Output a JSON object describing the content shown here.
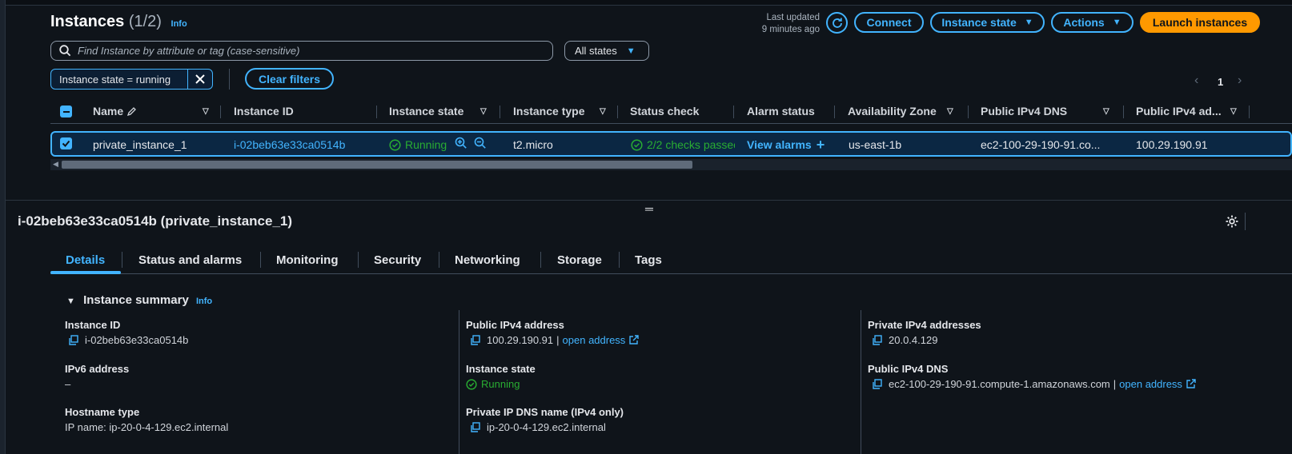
{
  "header": {
    "title": "Instances",
    "count": "(1/2)",
    "info": "Info",
    "last_updated_line1": "Last updated",
    "last_updated_line2": "9 minutes ago",
    "connect": "Connect",
    "instance_state": "Instance state",
    "actions": "Actions",
    "launch": "Launch instances"
  },
  "search": {
    "placeholder": "Find Instance by attribute or tag (case-sensitive)",
    "states": "All states"
  },
  "filters": {
    "token": "Instance state = running",
    "clear": "Clear filters"
  },
  "pagination": {
    "page": "1"
  },
  "table": {
    "columns": [
      "Name",
      "Instance ID",
      "Instance state",
      "Instance type",
      "Status check",
      "Alarm status",
      "Availability Zone",
      "Public IPv4 DNS",
      "Public IPv4 ad..."
    ],
    "row": {
      "name": "private_instance_1",
      "id": "i-02beb63e33ca0514b",
      "state": "Running",
      "type": "t2.micro",
      "status": "2/2 checks passec",
      "alarm": "View alarms",
      "az": "us-east-1b",
      "dns": "ec2-100-29-190-91.co...",
      "ipv4": "100.29.190.91"
    }
  },
  "detail": {
    "title": "i-02beb63e33ca0514b (private_instance_1)",
    "tabs": [
      "Details",
      "Status and alarms",
      "Monitoring",
      "Security",
      "Networking",
      "Storage",
      "Tags"
    ],
    "summary_title": "Instance summary",
    "info": "Info",
    "fields": {
      "instance_id_label": "Instance ID",
      "instance_id_value": "i-02beb63e33ca0514b",
      "ipv6_label": "IPv6 address",
      "ipv6_value": "–",
      "hostname_label": "Hostname type",
      "hostname_value": "IP name: ip-20-0-4-129.ec2.internal",
      "public_ipv4_label": "Public IPv4 address",
      "public_ipv4_value": "100.29.190.91",
      "open_address": "open address",
      "instance_state_label": "Instance state",
      "instance_state_value": "Running",
      "private_dns_label": "Private IP DNS name (IPv4 only)",
      "private_dns_value": "ip-20-0-4-129.ec2.internal",
      "private_ipv4_label": "Private IPv4 addresses",
      "private_ipv4_value": "20.0.4.129",
      "public_dns_label": "Public IPv4 DNS",
      "public_dns_value": "ec2-100-29-190-91.compute-1.amazonaws.com"
    }
  }
}
